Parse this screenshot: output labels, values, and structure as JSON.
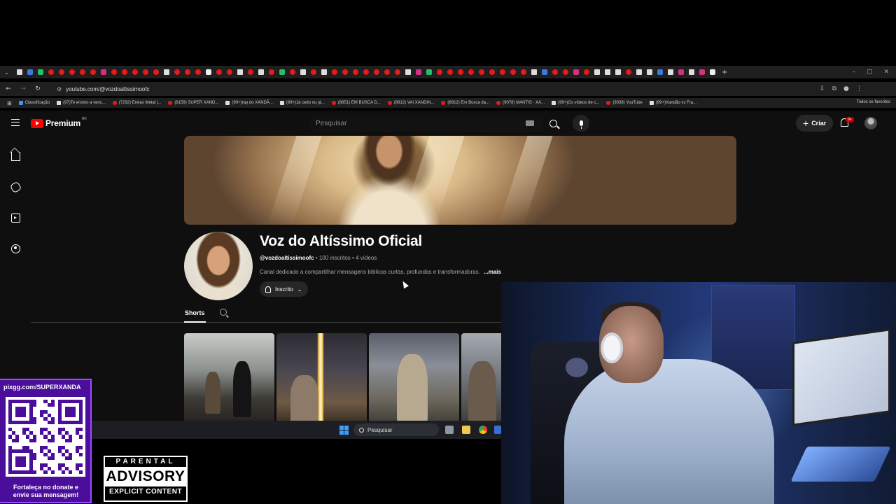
{
  "browser": {
    "tab_icons": [
      "tt",
      "bl",
      "gn",
      "yt",
      "yt",
      "yt",
      "yt",
      "yt",
      "ig",
      "yt",
      "yt",
      "yt",
      "yt",
      "yt",
      "tt",
      "yt",
      "yt",
      "yt",
      "wh",
      "yt",
      "yt",
      "tt",
      "yt",
      "tt",
      "yt",
      "gn",
      "yt",
      "tt",
      "yt",
      "tt",
      "yt",
      "yt",
      "yt",
      "yt",
      "yt",
      "yt",
      "yt",
      "tt",
      "ig",
      "gn",
      "yt",
      "yt",
      "yt",
      "yt",
      "yt",
      "yt",
      "yt",
      "yt",
      "yt",
      "tt",
      "bl",
      "yt",
      "yt",
      "ig",
      "yt",
      "tt",
      "tt",
      "tt",
      "yt",
      "tt",
      "tt",
      "bl",
      "tt",
      "ig",
      "tt",
      "ig",
      "wh"
    ],
    "window_controls": [
      "–",
      "▢",
      "✕"
    ],
    "new_tab": "+",
    "url": "youtube.com/@vozdoaltissimoofc",
    "bookmarks": [
      {
        "label": "Classificação",
        "icon": "bl"
      },
      {
        "label": "(97)Te ensino a venc...",
        "icon": "tt"
      },
      {
        "label": "(7292) Enéas Metal |...",
        "icon": "yt"
      },
      {
        "label": "(8159) SUPER XAND...",
        "icon": "yt"
      },
      {
        "label": "(99+)rap do XANDÃ...",
        "icon": "tt"
      },
      {
        "label": "(99+)Já cedo ou já...",
        "icon": "tt"
      },
      {
        "label": "(8851) EM BUSCA D...",
        "icon": "yt"
      },
      {
        "label": "(8912) VAI XANDIN...",
        "icon": "yt"
      },
      {
        "label": "(8912) Em Busca da...",
        "icon": "yt"
      },
      {
        "label": "(9078) MANTIS · XA...",
        "icon": "yt"
      },
      {
        "label": "(99+)Os vídeos de c...",
        "icon": "tt"
      },
      {
        "label": "(9338) YouTube",
        "icon": "yt"
      },
      {
        "label": "(99+)Xandão vs Fra...",
        "icon": "tt"
      }
    ],
    "all_bookmarks": "Todos os favoritos"
  },
  "youtube": {
    "brand": "Premium",
    "region": "BR",
    "search_placeholder": "Pesquisar",
    "create_label": "Criar",
    "notification_count": "9+"
  },
  "channel": {
    "name": "Voz do Altíssimo Oficial",
    "handle": "@vozdoaltissimoofc",
    "subscribers": "100 inscritos",
    "videos": "4 vídeos",
    "description": "Canal dedicado a compartilhar mensagens bíblicas curtas, profundas e transformadoras.",
    "more": "...mais",
    "subscribe_label": "Inscrito",
    "tab_shorts": "Shorts"
  },
  "taskbar": {
    "search_placeholder": "Pesquisar"
  },
  "overlay": {
    "donate_url": "pixgg.com/SUPERXANDA",
    "donate_message_line1": "Fortaleça no donate e",
    "donate_message_line2": "envie sua mensagem!",
    "advisory_top": "PARENTAL",
    "advisory_mid": "ADVISORY",
    "advisory_bottom": "EXPLICIT CONTENT"
  }
}
